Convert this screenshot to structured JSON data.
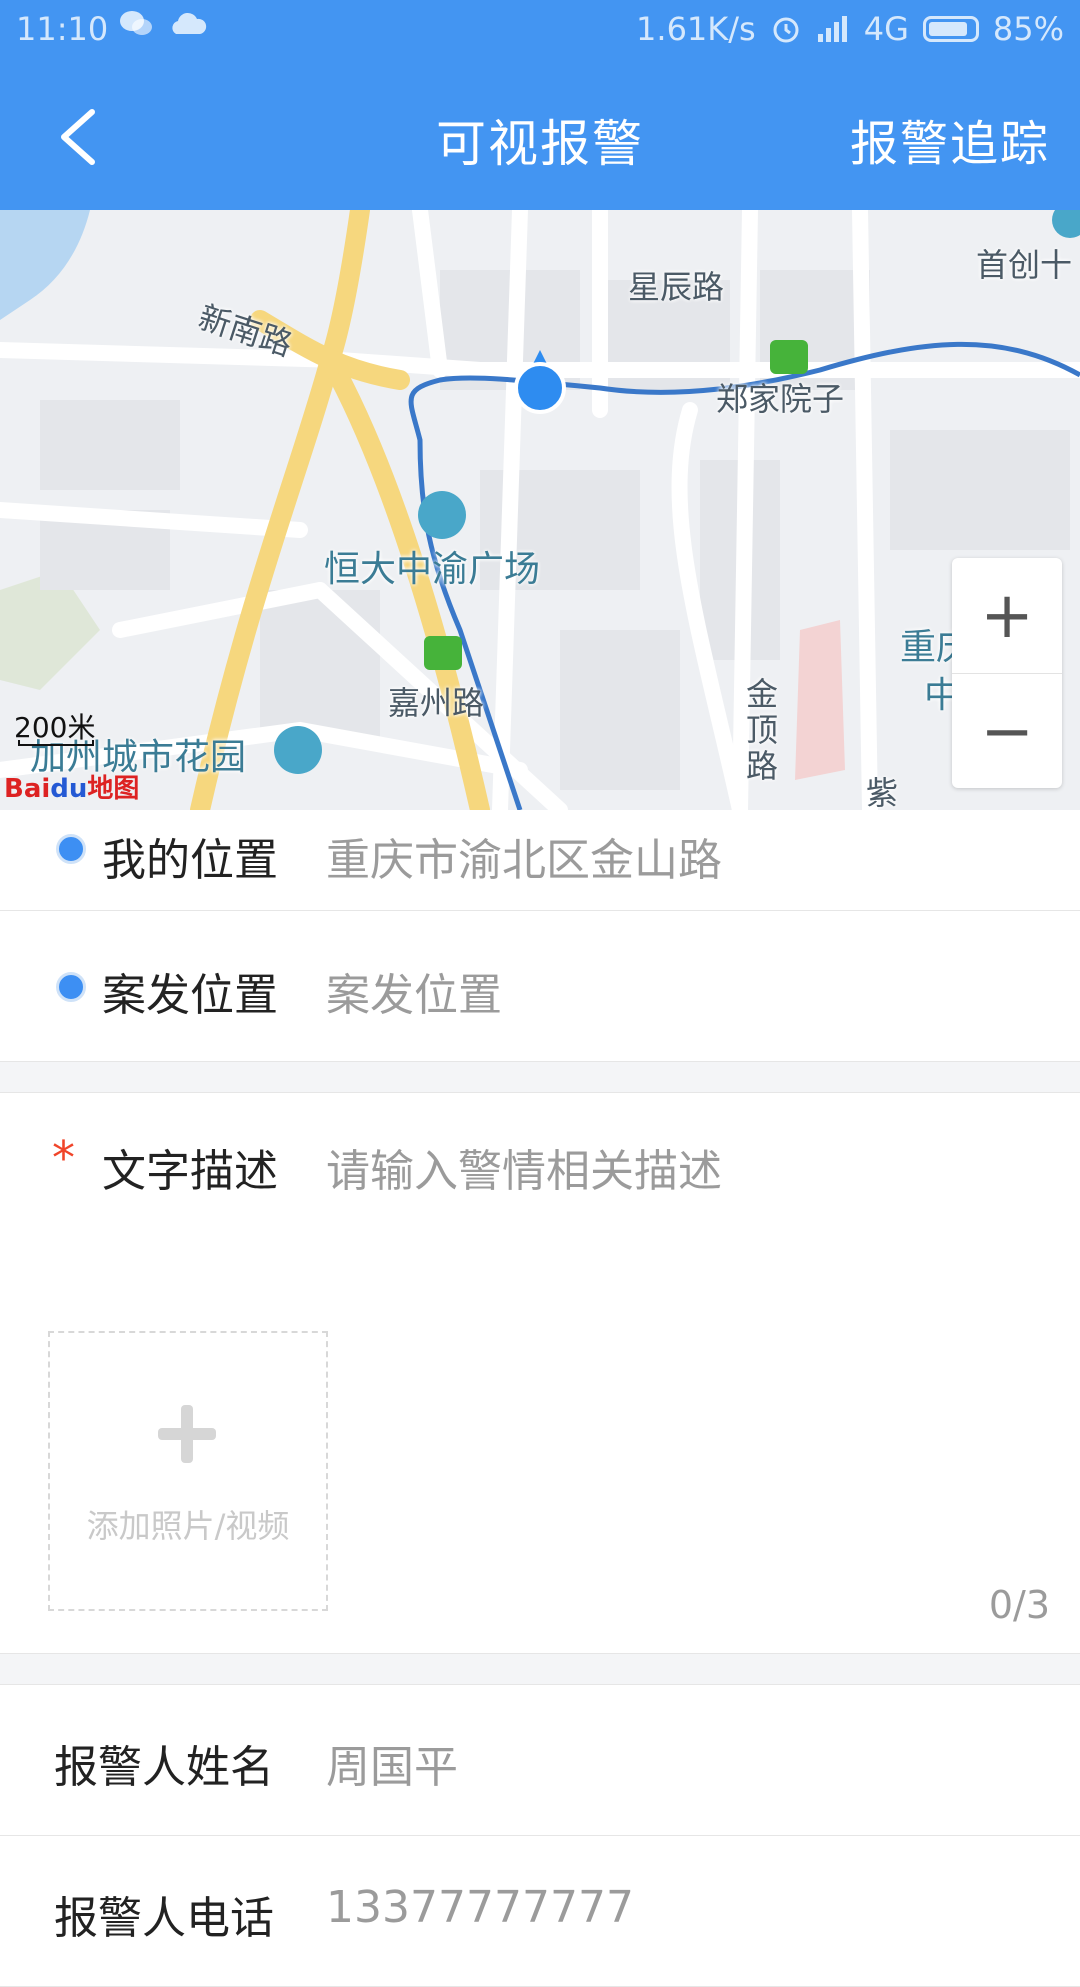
{
  "status_bar": {
    "time": "11:10",
    "network_speed": "1.61K/s",
    "network_type": "4G",
    "battery": "85%",
    "icons": [
      "wechat-icon",
      "cloud-icon",
      "alarm-icon",
      "signal-icon",
      "battery-icon"
    ]
  },
  "nav": {
    "back_icon": "chevron-left-icon",
    "title": "可视报警",
    "action": "报警追踪"
  },
  "map": {
    "labels": {
      "xingchen": "星辰路",
      "shouchuang": "首创十",
      "xinnan": "新南路",
      "zhengjia": "郑家院子",
      "hengda": "恒大中渝广场",
      "jiazhou": "嘉州路",
      "jiazhou_garden": "加州城市花园",
      "jinding": "金顶路",
      "zi": "紫",
      "chongqing": "重庆",
      "zhong": "中"
    },
    "zoom_in": "+",
    "zoom_out": "−",
    "scale": "200米",
    "logo_bai": "Bai",
    "logo_du": "du",
    "logo_map": "地图",
    "colors": {
      "route": "#3a78c9",
      "highway": "#f6d77e",
      "location": "#2e8cf0"
    }
  },
  "form": {
    "my_location": {
      "label": "我的位置",
      "value": "重庆市渝北区金山路"
    },
    "incident_location": {
      "label": "案发位置",
      "placeholder": "案发位置"
    },
    "description": {
      "required_mark": "*",
      "label": "文字描述",
      "placeholder": "请输入警情相关描述",
      "upload_label": "添加照片/视频",
      "count": "0/3"
    },
    "reporter_name": {
      "label": "报警人姓名",
      "value": "周国平"
    },
    "reporter_phone": {
      "label": "报警人电话",
      "value": "13377777777"
    }
  },
  "colors": {
    "accent": "#4395f2",
    "required": "#f0452a"
  }
}
